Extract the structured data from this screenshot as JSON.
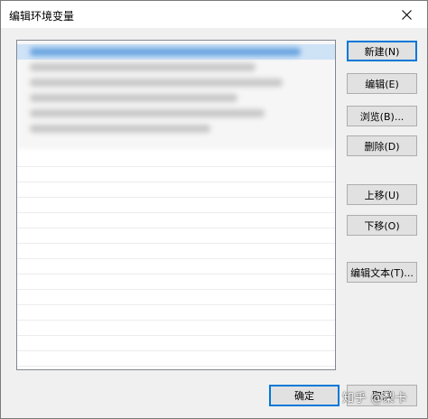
{
  "window": {
    "title": "编辑环境变量"
  },
  "buttons": {
    "new": "新建(N)",
    "edit": "编辑(E)",
    "browse": "浏览(B)...",
    "delete": "删除(D)",
    "move_up": "上移(U)",
    "move_down": "下移(O)",
    "edit_text": "编辑文本(T)...",
    "ok": "确定",
    "cancel": "取消"
  },
  "watermark": "知乎 @梨卡",
  "colors": {
    "accent": "#0078d7",
    "selection": "#cfe3f7"
  },
  "icons": {
    "close": "close-icon"
  }
}
